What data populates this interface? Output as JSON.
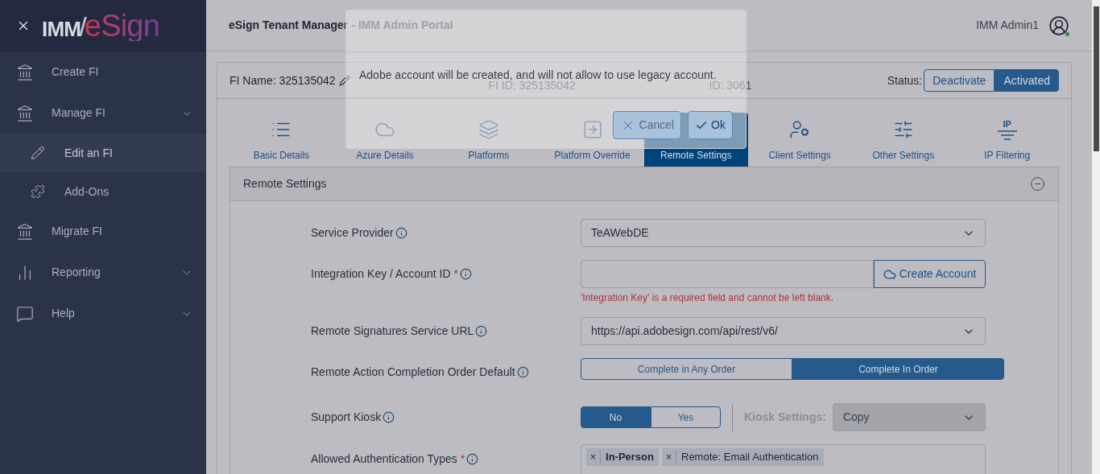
{
  "sidebar": {
    "logo": {
      "left": "IMM",
      "separator": "/",
      "right": "eSign"
    },
    "items": [
      {
        "label": "Create FI",
        "expandable": false,
        "selected": false
      },
      {
        "label": "Manage FI",
        "expandable": true,
        "selected": false,
        "children": [
          {
            "label": "Edit an FI",
            "selected": true
          },
          {
            "label": "Add-Ons",
            "selected": false
          }
        ]
      },
      {
        "label": "Migrate FI",
        "expandable": false,
        "selected": false
      },
      {
        "label": "Reporting",
        "expandable": true,
        "selected": false
      },
      {
        "label": "Help",
        "expandable": true,
        "selected": false
      }
    ]
  },
  "header": {
    "title": "eSign Tenant Manager",
    "subtitle": "- IMM Admin Portal",
    "user": {
      "name": "IMM Admin1",
      "online": true
    }
  },
  "fi": {
    "name": "FI Name: 325135042",
    "fi_id": "FI ID: 325135042",
    "id": "ID: 3061",
    "status_label": "Status:",
    "status_options": [
      {
        "label": "Deactivate",
        "selected": false
      },
      {
        "label": "Activated",
        "selected": true
      }
    ]
  },
  "tabs": [
    {
      "label": "Basic Details",
      "selected": false
    },
    {
      "label": "Azure Details",
      "selected": false
    },
    {
      "label": "Platforms",
      "selected": false
    },
    {
      "label": "Platform Override",
      "selected": false
    },
    {
      "label": "Remote Settings",
      "selected": true
    },
    {
      "label": "Client Settings",
      "selected": false
    },
    {
      "label": "Other Settings",
      "selected": false
    },
    {
      "label": "IP Filtering",
      "selected": false,
      "icon_text": "IP"
    }
  ],
  "section": {
    "title": "Remote Settings",
    "expanded": true,
    "required_mark": "*",
    "fields": [
      {
        "kind": "select",
        "label": "Service Provider",
        "required": false,
        "value": "TeAWebDE"
      },
      {
        "kind": "input_button",
        "label": "Integration Key / Account ID",
        "required": true,
        "button": "Create Account",
        "error": "'Integration Key' is a required field and cannot be left blank."
      },
      {
        "kind": "select",
        "label": "Remote Signatures Service URL",
        "required": false,
        "value": "https://api.adobesign.com/api/rest/v6/"
      },
      {
        "kind": "segmented",
        "label": "Remote Action Completion Order Default",
        "required": false,
        "options": [
          {
            "label": "Complete in Any Order",
            "selected": false
          },
          {
            "label": "Complete In Order",
            "selected": true
          }
        ]
      },
      {
        "kind": "kiosk",
        "label": "Support Kiosk",
        "required": false,
        "options": [
          {
            "label": "No",
            "selected": true
          },
          {
            "label": "Yes",
            "selected": false
          }
        ],
        "settings_label": "Kiosk Settings:",
        "settings_value": "Copy",
        "settings_disabled": true
      },
      {
        "kind": "tags",
        "label": "Allowed Authentication Types",
        "required": true,
        "remove": "×",
        "tags": [
          {
            "label": "In-Person",
            "emphasized": true
          },
          {
            "label": "Remote: Email Authentication",
            "emphasized": false
          }
        ]
      }
    ]
  },
  "dialog": {
    "message": "Adobe account will be created, and will not allow to use legacy account.",
    "buttons": [
      {
        "kind": "cancel",
        "label": "Cancel",
        "disabled": true
      },
      {
        "kind": "ok",
        "label": "Ok",
        "disabled": false
      }
    ]
  }
}
